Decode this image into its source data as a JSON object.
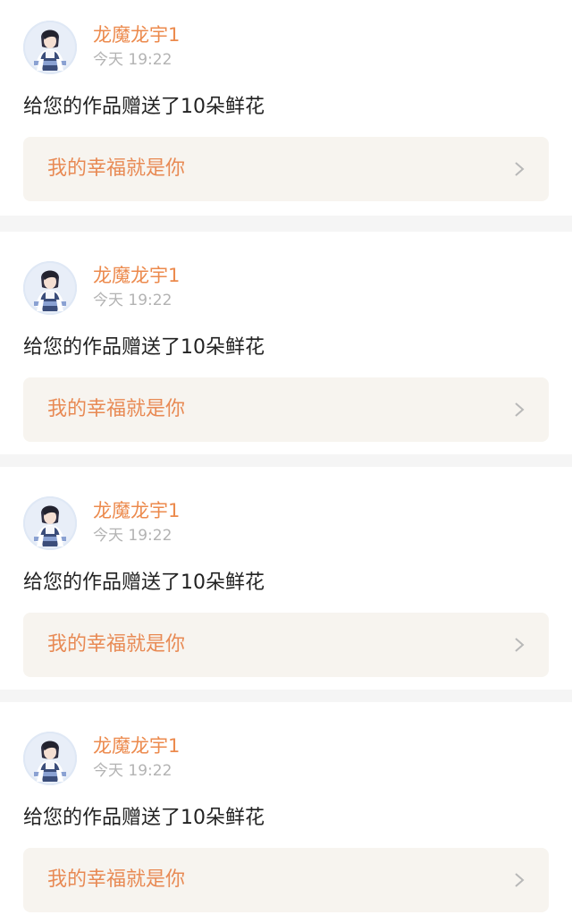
{
  "notifications": [
    {
      "username": "龙魔龙宇1",
      "time": "今天 19:22",
      "message": "给您的作品赠送了10朵鲜花",
      "work_title": "我的幸福就是你",
      "avatar_icon": "anime-boy-avatar",
      "chevron_icon": "chevron-right-icon"
    },
    {
      "username": "龙魔龙宇1",
      "time": "今天 19:22",
      "message": "给您的作品赠送了10朵鲜花",
      "work_title": "我的幸福就是你",
      "avatar_icon": "anime-boy-avatar",
      "chevron_icon": "chevron-right-icon"
    },
    {
      "username": "龙魔龙宇1",
      "time": "今天 19:22",
      "message": "给您的作品赠送了10朵鲜花",
      "work_title": "我的幸福就是你",
      "avatar_icon": "anime-boy-avatar",
      "chevron_icon": "chevron-right-icon"
    },
    {
      "username": "龙魔龙宇1",
      "time": "今天 19:22",
      "message": "给您的作品赠送了10朵鲜花",
      "work_title": "我的幸福就是你",
      "avatar_icon": "anime-boy-avatar",
      "chevron_icon": "chevron-right-icon"
    }
  ],
  "colors": {
    "page_background": "#f5f5f5",
    "card_background": "#ffffff",
    "username": "#ec8a4d",
    "work_title": "#e88a54",
    "timestamp": "#b3b3b3",
    "message": "#222222",
    "link_background": "#f7f4ef",
    "chevron": "#b8b8b8"
  }
}
